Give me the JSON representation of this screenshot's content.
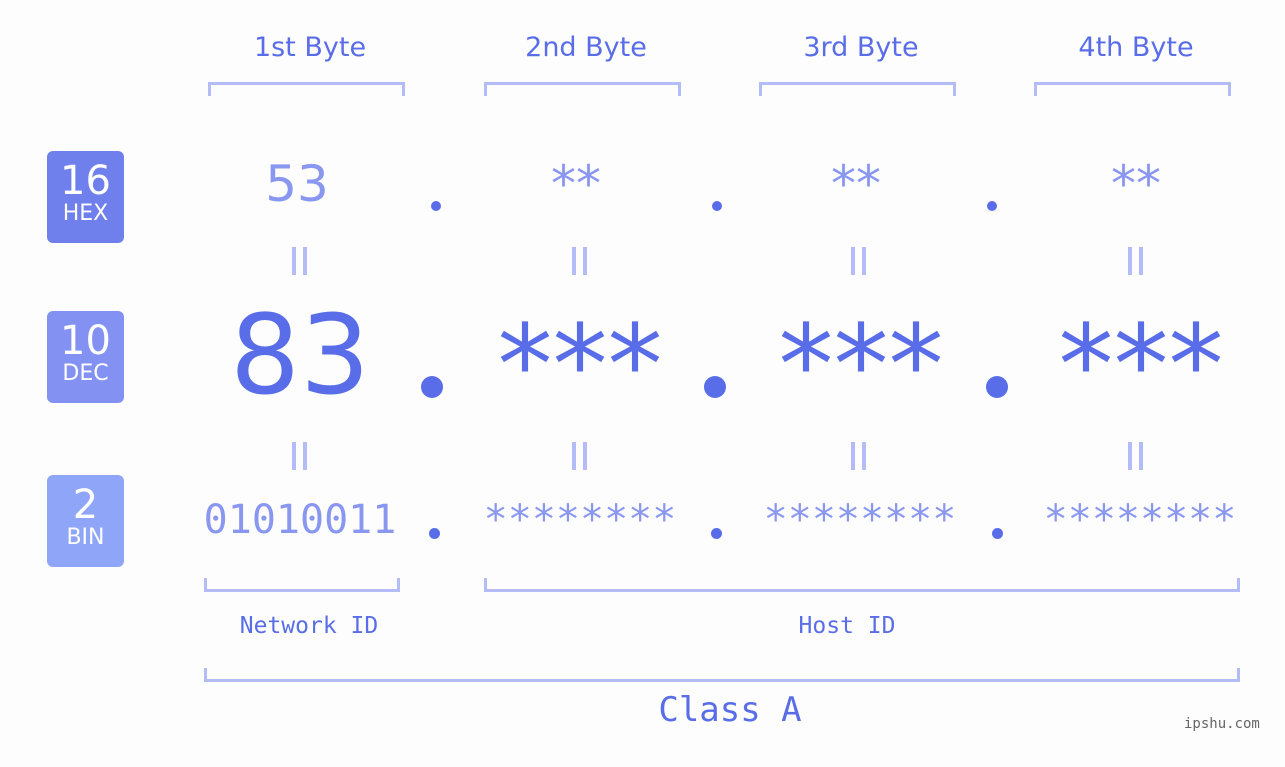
{
  "byte_headers": [
    "1st Byte",
    "2nd Byte",
    "3rd Byte",
    "4th Byte"
  ],
  "badges": [
    {
      "number": "16",
      "label": "HEX",
      "color": "#6f7fec"
    },
    {
      "number": "10",
      "label": "DEC",
      "color": "#8291f2"
    },
    {
      "number": "2",
      "label": "BIN",
      "color": "#8fa6f8"
    }
  ],
  "hex_values": [
    "53",
    "**",
    "**",
    "**"
  ],
  "dec_values": [
    "83",
    "***",
    "***",
    "***"
  ],
  "bin_values": [
    "01010011",
    "********",
    "********",
    "********"
  ],
  "network_id_label": "Network ID",
  "host_id_label": "Host ID",
  "class_label": "Class A",
  "watermark": "ipshu.com",
  "colors": {
    "accent": "#5a6de8",
    "light": "#8a97f0",
    "bracket": "#b4bcf8"
  }
}
